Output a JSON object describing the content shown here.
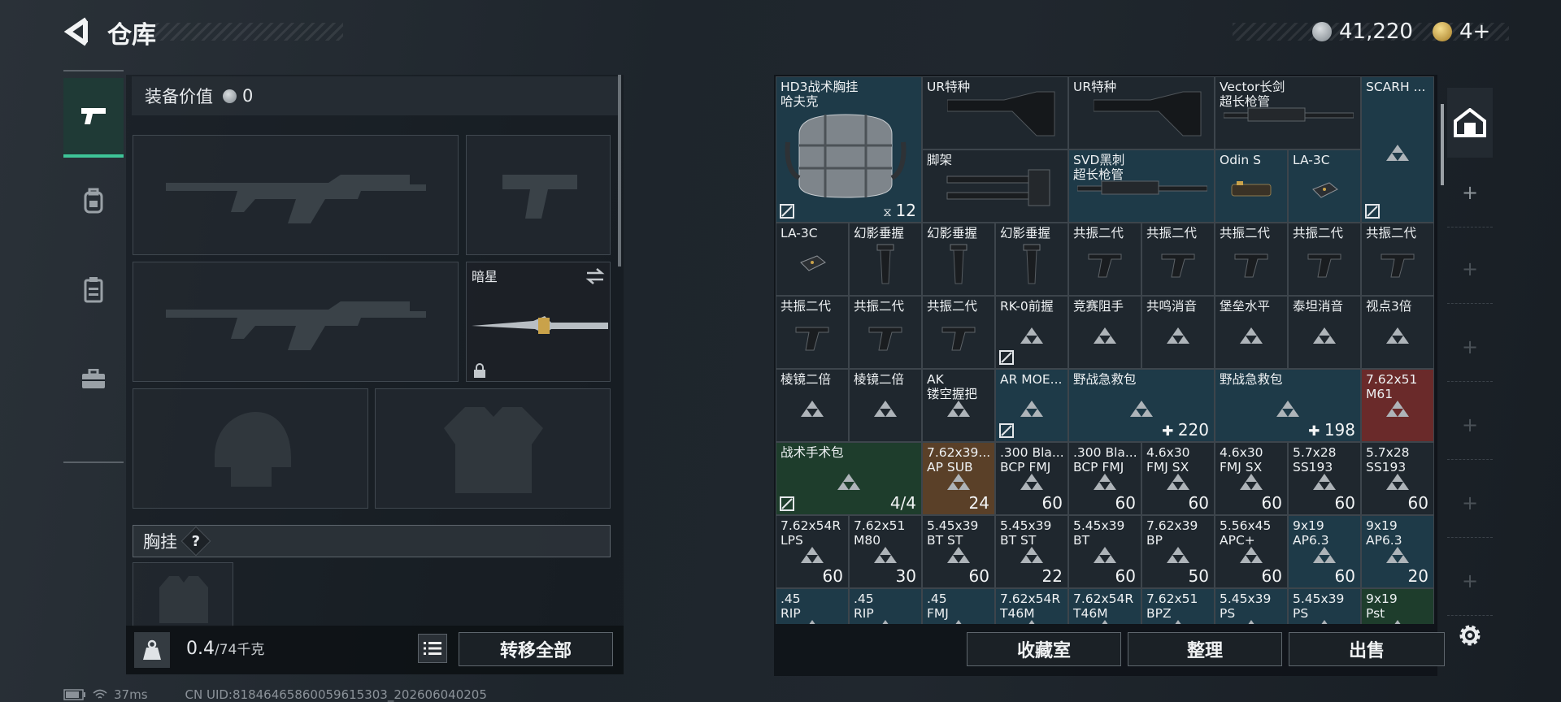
{
  "header": {
    "title": "仓库",
    "currency1": "41,220",
    "currency2": "4+"
  },
  "tabs": [
    {
      "icon": "gun-icon",
      "active": true
    },
    {
      "icon": "backpack-icon",
      "active": false
    },
    {
      "icon": "vest-icon",
      "active": false
    },
    {
      "icon": "toolbox-icon",
      "active": false
    }
  ],
  "equipment": {
    "value_label": "装备价值",
    "value": "0",
    "melee_name": "暗星",
    "bandolier_label": "胸挂",
    "bandolier_help": "?",
    "weight_current": "0.4",
    "weight_max": "/74千克",
    "transfer_all": "转移全部"
  },
  "grid": {
    "items": [
      {
        "name": "HD3战术胸挂\n哈夫克",
        "count": "12",
        "lock": true,
        "capacity_icon": true
      },
      {
        "name": "UR特种"
      },
      {
        "name": "UR特种"
      },
      {
        "name": "Vector长剑\n超长枪管"
      },
      {
        "name": "SCARH ...",
        "lock": true
      },
      {
        "name": "脚架"
      },
      {
        "name": "SVD黑刺\n超长枪管"
      },
      {
        "name": "Odin S"
      },
      {
        "name": "LA-3C"
      },
      {
        "name": "LA-3C"
      },
      {
        "name": "幻影垂握"
      },
      {
        "name": "幻影垂握"
      },
      {
        "name": "幻影垂握"
      },
      {
        "name": "共振二代"
      },
      {
        "name": "共振二代"
      },
      {
        "name": "共振二代"
      },
      {
        "name": "共振二代"
      },
      {
        "name": "共振二代"
      },
      {
        "name": "共振二代"
      },
      {
        "name": "共振二代"
      },
      {
        "name": "共振二代"
      },
      {
        "name": "RK-0前握",
        "lock": true
      },
      {
        "name": "竞赛阻手"
      },
      {
        "name": "共鸣消音"
      },
      {
        "name": "堡垒水平"
      },
      {
        "name": "泰坦消音"
      },
      {
        "name": "视点3倍"
      },
      {
        "name": "棱镜二倍"
      },
      {
        "name": "棱镜二倍"
      },
      {
        "name": "AK\n镂空握把"
      },
      {
        "name": "AR MOE...",
        "lock": true
      },
      {
        "name": "野战急救包",
        "count": "220",
        "plus": true
      },
      {
        "name": "野战急救包",
        "count": "198",
        "plus": true
      },
      {
        "name": "7.62x51\nM61"
      },
      {
        "name": "战术手术包",
        "count": "4/4",
        "lock": true
      },
      {
        "name": "7.62x39...\nAP SUB",
        "count": "24"
      },
      {
        "name": ".300 Bla...\nBCP FMJ",
        "count": "60"
      },
      {
        "name": ".300 Bla...\nBCP FMJ",
        "count": "60"
      },
      {
        "name": "4.6x30\nFMJ SX",
        "count": "60"
      },
      {
        "name": "4.6x30\nFMJ SX",
        "count": "60"
      },
      {
        "name": "5.7x28\nSS193",
        "count": "60"
      },
      {
        "name": "5.7x28\nSS193",
        "count": "60"
      },
      {
        "name": "7.62x54R\nLPS",
        "count": "60"
      },
      {
        "name": "7.62x51\nM80",
        "count": "30"
      },
      {
        "name": "5.45x39\nBT ST",
        "count": "60"
      },
      {
        "name": "5.45x39\nBT ST",
        "count": "22"
      },
      {
        "name": "5.45x39\nBT",
        "count": "60"
      },
      {
        "name": "7.62x39\nBP",
        "count": "50"
      },
      {
        "name": "5.56x45\nAPC+",
        "count": "60"
      },
      {
        "name": "9x19\nAP6.3",
        "count": "60"
      },
      {
        "name": "9x19\nAP6.3",
        "count": "20"
      },
      {
        "name": ".45\nRIP"
      },
      {
        "name": ".45\nRIP"
      },
      {
        "name": ".45\nFMJ"
      },
      {
        "name": "7.62x54R\nT46M"
      },
      {
        "name": "7.62x54R\nT46M"
      },
      {
        "name": "7.62x51\nBPZ"
      },
      {
        "name": "5.45x39\nPS"
      },
      {
        "name": "5.45x39\nPS"
      },
      {
        "name": "9x19\nPst"
      }
    ]
  },
  "actions": {
    "collection": "收藏室",
    "sort": "整理",
    "sell": "出售"
  },
  "status": {
    "ping": "37ms",
    "uid": "CN UID:81846465860059615303_202606040205"
  },
  "colors": {
    "accent": "#3ec497",
    "cell_default": "#1f272e",
    "cell_blue": "#1e3a48",
    "cell_green": "#1e3d2c",
    "cell_orange": "#5a4028",
    "cell_red": "#6a2a2a"
  }
}
